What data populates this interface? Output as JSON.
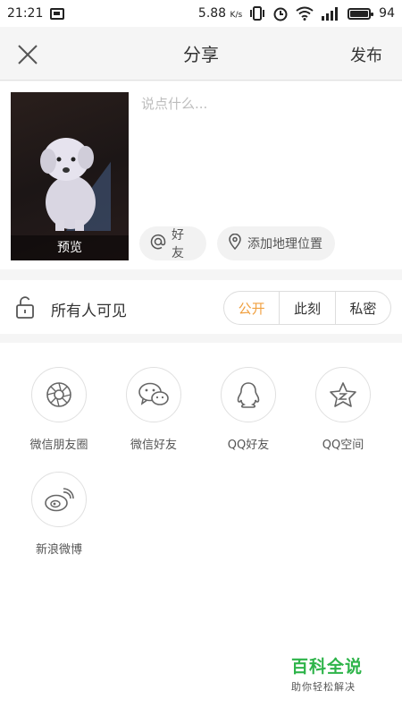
{
  "status_bar": {
    "time": "21:21",
    "network_speed": "5.88",
    "network_unit": "K/s",
    "battery": "94"
  },
  "header": {
    "title": "分享",
    "publish_label": "发布",
    "close_icon": "close-icon"
  },
  "composer": {
    "placeholder": "说点什么...",
    "preview_label": "预览",
    "mention_label": "好友",
    "location_label": "添加地理位置"
  },
  "visibility": {
    "label": "所有人可见",
    "options": [
      "公开",
      "此刻",
      "私密"
    ],
    "selected": "公开",
    "accent_color": "#f0a040"
  },
  "share_targets": [
    {
      "label": "微信朋友圈",
      "icon": "moments-icon"
    },
    {
      "label": "微信好友",
      "icon": "wechat-icon"
    },
    {
      "label": "QQ好友",
      "icon": "qq-icon"
    },
    {
      "label": "QQ空间",
      "icon": "qzone-icon"
    },
    {
      "label": "新浪微博",
      "icon": "weibo-icon"
    }
  ],
  "watermark": {
    "title": "百科全说",
    "subtitle": "助你轻松解决",
    "color": "#2eb44a"
  }
}
